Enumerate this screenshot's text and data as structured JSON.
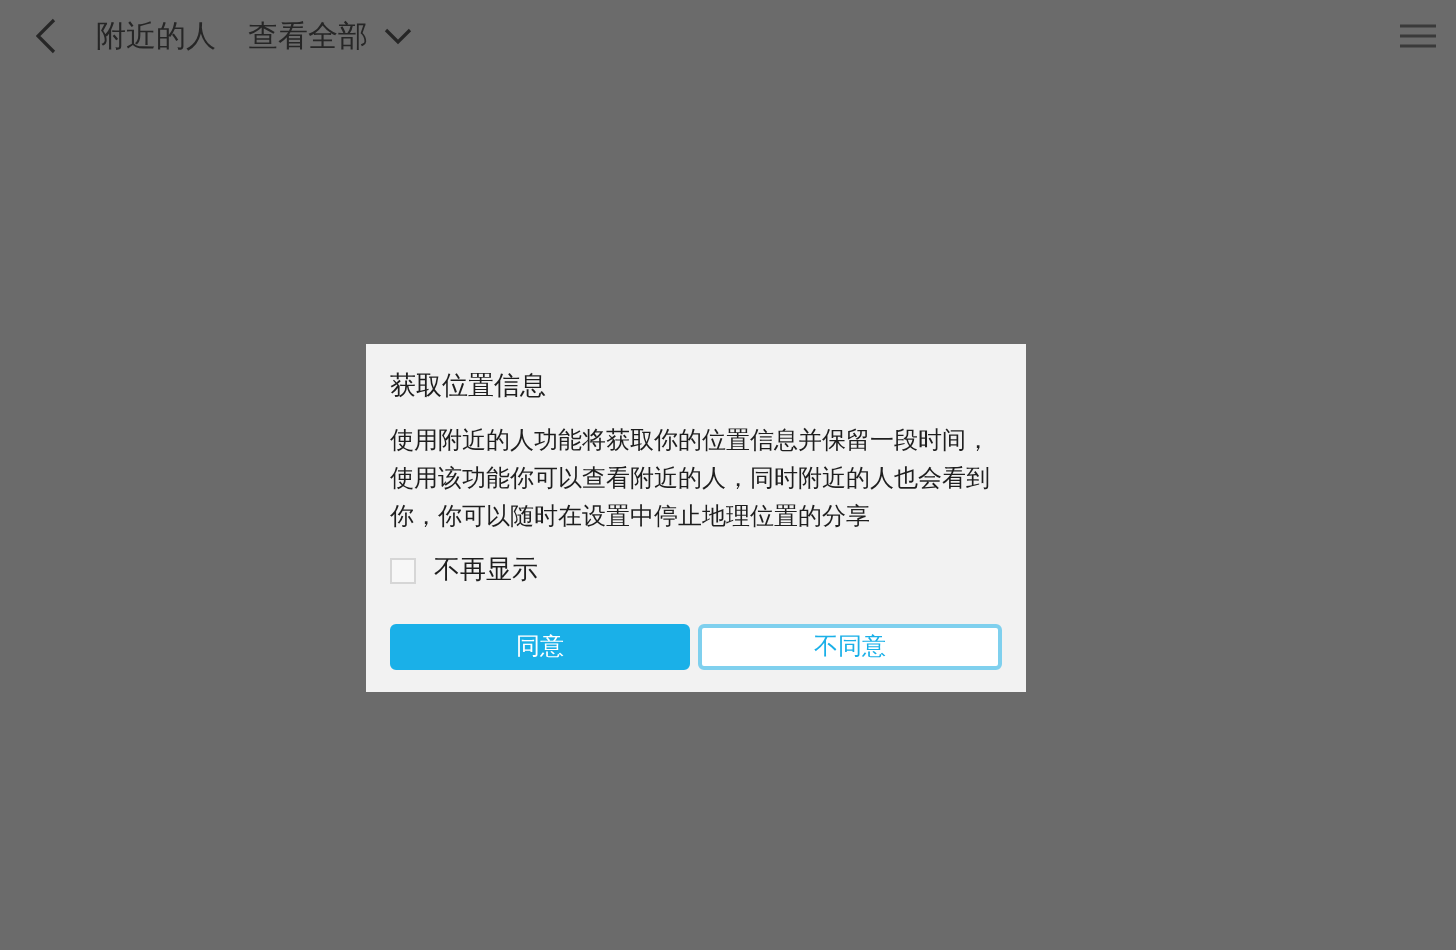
{
  "header": {
    "title": "附近的人",
    "filter": "查看全部"
  },
  "dialog": {
    "title": "获取位置信息",
    "message": "使用附近的人功能将获取你的位置信息并保留一段时间，使用该功能你可以查看附近的人，同时附近的人也会看到你，你可以随时在设置中停止地理位置的分享",
    "checkbox": {
      "label": "不再显示",
      "checked": false
    },
    "buttons": [
      {
        "label": "同意",
        "kind": "primary"
      },
      {
        "label": "不同意",
        "kind": "secondary"
      }
    ]
  }
}
